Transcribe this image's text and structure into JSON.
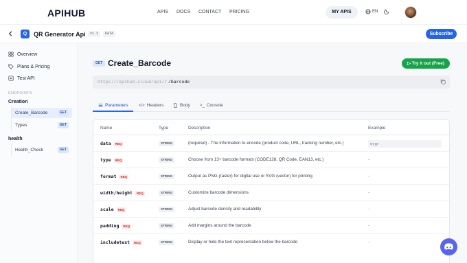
{
  "header": {
    "logo": "APIHUB",
    "nav": [
      "APIS",
      "DOCS",
      "CONTACT",
      "PRICING"
    ],
    "my_apis": "MY APIS",
    "lang": "EN"
  },
  "subheader": {
    "api_icon_letter": "Q",
    "api_name": "QR Generator Api",
    "version": "v1.1",
    "category": "DATA",
    "subscribe": "Subscribe"
  },
  "sidebar": {
    "overview": "Overview",
    "plans": "Plans & Pricing",
    "test_api": "Test API",
    "endpoints_label": "ENDPOINTS",
    "groups": [
      {
        "name": "Creation",
        "items": [
          {
            "label": "Create_Barcode",
            "method": "GET"
          },
          {
            "label": "Types",
            "method": "GET"
          }
        ]
      },
      {
        "name": "health",
        "items": [
          {
            "label": "Health_Check",
            "method": "GET"
          }
        ]
      }
    ]
  },
  "endpoint": {
    "method": "GET",
    "title": "Create_Barcode",
    "try_it": "Try it out (Free)",
    "url_base": "https://apihub.cloud/api/r",
    "url_path": "/barcode"
  },
  "tabs": [
    "Parameters",
    "Headers",
    "Body",
    "Console"
  ],
  "table": {
    "headers": [
      "Name",
      "Type",
      "Description",
      "Example"
    ],
    "req_label": "REQ",
    "rows": [
      {
        "name": "data",
        "type": "STRING",
        "description": "(required) - The information to encode (product code, URL, tracking number, etc.)",
        "example": "eygr"
      },
      {
        "name": "type",
        "type": "STRING",
        "description": "Choose from 13+ barcode formats (CODE128, QR Code, EAN13, etc.)",
        "example": "-"
      },
      {
        "name": "format",
        "type": "STRING",
        "description": "Output as PNG (raster) for digital use or SVG (vector) for printing",
        "example": "-"
      },
      {
        "name": "width/height",
        "type": "STRING",
        "description": "Customize barcode dimensions",
        "example": "-"
      },
      {
        "name": "scale",
        "type": "STRING",
        "description": "Adjust barcode density and readability",
        "example": "-"
      },
      {
        "name": "padding",
        "type": "STRING",
        "description": "Add margins around the barcode",
        "example": "-"
      },
      {
        "name": "includetext",
        "type": "STRING",
        "description": "Display or hide the text representation below the barcode",
        "example": "-"
      }
    ]
  },
  "colors": {
    "accent": "#2563eb",
    "success": "#16a34a",
    "required": "#dc2626",
    "discord": "#5865f2"
  }
}
